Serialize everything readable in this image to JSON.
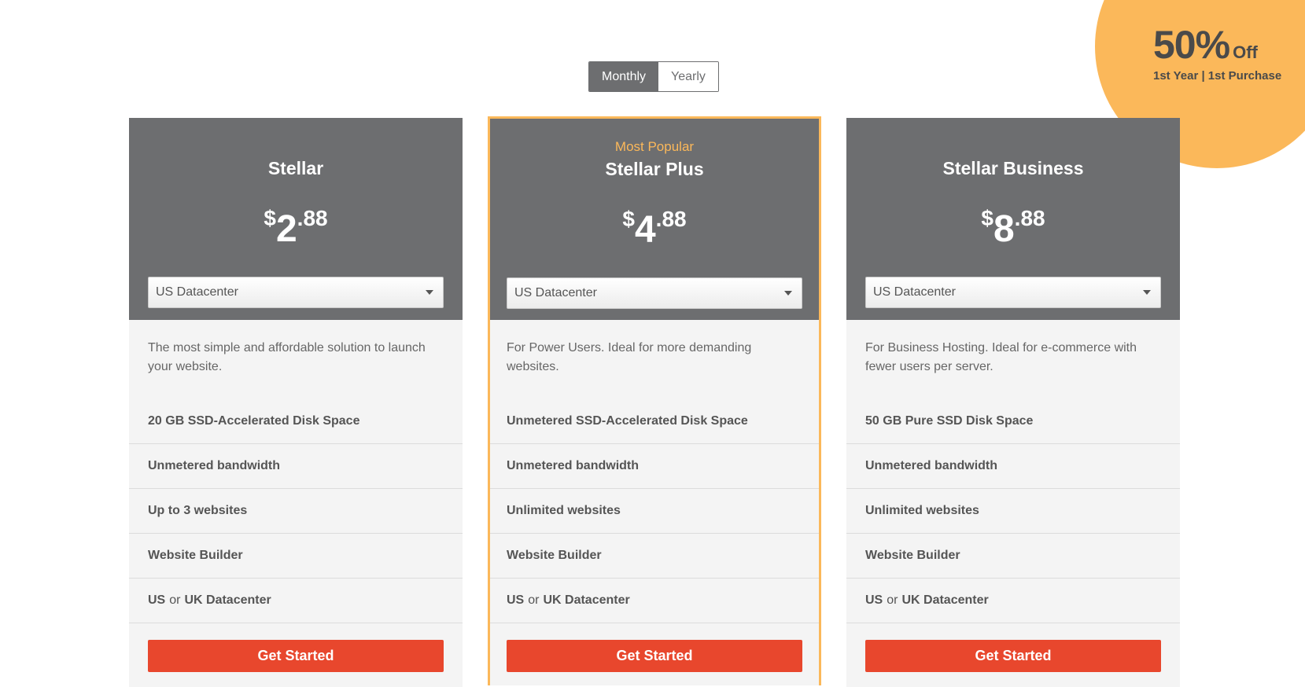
{
  "promo": {
    "big": "50%",
    "off": "Off",
    "sub": "1st Year | 1st Purchase"
  },
  "toggle": {
    "monthly": "Monthly",
    "yearly": "Yearly"
  },
  "plans": [
    {
      "badge": "",
      "name": "Stellar",
      "price": {
        "currency": "$",
        "int": "2",
        "dec": ".88"
      },
      "datacenter": "US Datacenter",
      "description": "The most simple and affordable solution to launch your website.",
      "features": [
        "20 GB SSD-Accelerated Disk Space",
        "Unmetered bandwidth",
        "Up to 3 websites",
        "Website Builder"
      ],
      "dc_feature": {
        "a": "US",
        "or": "or",
        "b": "UK Datacenter"
      },
      "cta": "Get Started"
    },
    {
      "badge": "Most Popular",
      "name": "Stellar Plus",
      "price": {
        "currency": "$",
        "int": "4",
        "dec": ".88"
      },
      "datacenter": "US Datacenter",
      "description": "For Power Users. Ideal for more demanding websites.",
      "features": [
        "Unmetered SSD-Accelerated Disk Space",
        "Unmetered bandwidth",
        "Unlimited websites",
        "Website Builder"
      ],
      "dc_feature": {
        "a": "US",
        "or": "or",
        "b": "UK Datacenter"
      },
      "cta": "Get Started"
    },
    {
      "badge": "",
      "name": "Stellar Business",
      "price": {
        "currency": "$",
        "int": "8",
        "dec": ".88"
      },
      "datacenter": "US Datacenter",
      "description": "For Business Hosting. Ideal for e-commerce with fewer users per server.",
      "features": [
        "50 GB Pure SSD Disk Space",
        "Unmetered bandwidth",
        "Unlimited websites",
        "Website Builder"
      ],
      "dc_feature": {
        "a": "US",
        "or": "or",
        "b": "UK Datacenter"
      },
      "cta": "Get Started"
    }
  ],
  "colors": {
    "accent": "#fbb85a",
    "header": "#6d6e70",
    "cta": "#e8472d",
    "card_bg": "#f4f4f4"
  }
}
